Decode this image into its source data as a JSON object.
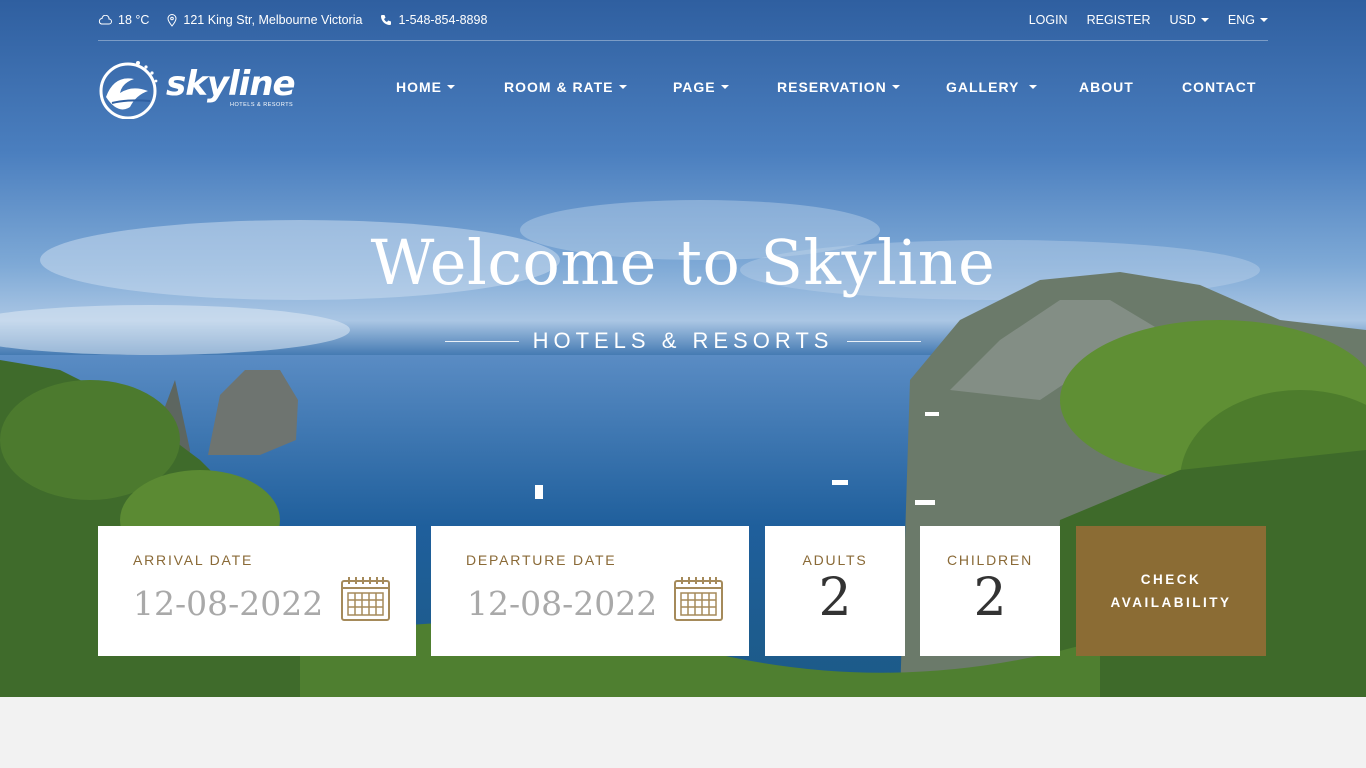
{
  "topbar": {
    "weather": "18 °C",
    "address": "121 King Str, Melbourne Victoria",
    "phone": "1-548-854-8898",
    "login": "LOGIN",
    "register": "REGISTER",
    "currency": "USD",
    "language": "ENG"
  },
  "logo": {
    "name": "skyline",
    "tagline": "HOTELS & RESORTS"
  },
  "nav": {
    "items": [
      {
        "label": "HOME"
      },
      {
        "label": "ROOM & RATE"
      },
      {
        "label": "PAGE"
      },
      {
        "label": "RESERVATION"
      },
      {
        "label": "GALLERY"
      },
      {
        "label": "ABOUT"
      },
      {
        "label": "CONTACT"
      }
    ]
  },
  "hero": {
    "title": "Welcome to Skyline",
    "subtitle": "HOTELS & RESORTS"
  },
  "booking": {
    "arrival_label": "ARRIVAL DATE",
    "arrival_value": "12-08-2022",
    "departure_label": "DEPARTURE DATE",
    "departure_value": "12-08-2022",
    "adults_label": "ADULTS",
    "adults_value": "2",
    "children_label": "CHILDREN",
    "children_value": "2",
    "check_line1": "CHECK",
    "check_line2": "AVAILABILITY"
  },
  "colors": {
    "accent": "#8b6c34",
    "label": "#8a6a37"
  }
}
